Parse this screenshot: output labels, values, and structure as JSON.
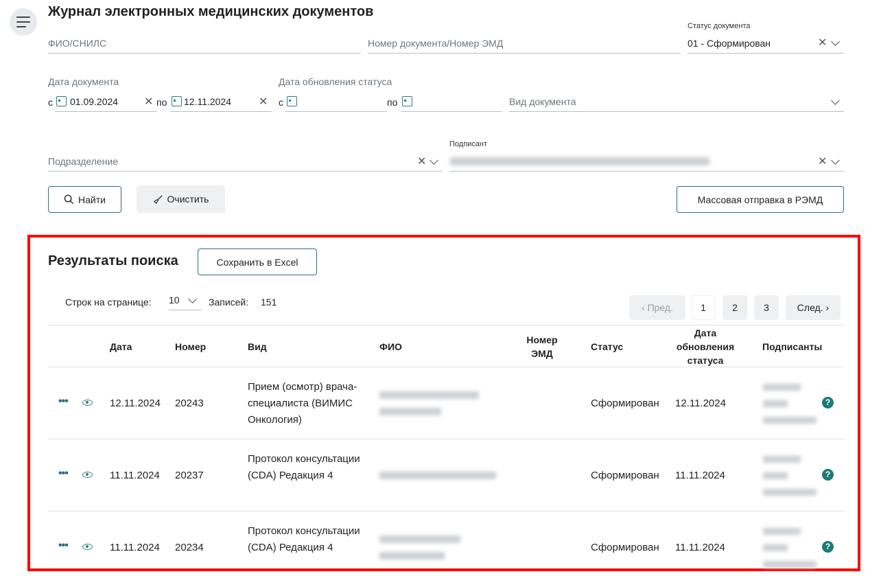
{
  "page_title": "Журнал электронных медицинских документов",
  "filters": {
    "fio_placeholder": "ФИО/СНИЛС",
    "number_placeholder": "Номер документа/Номер ЭМД",
    "status_label": "Статус документа",
    "status_value": "01 - Сформирован",
    "doc_date_label": "Дата документа",
    "from": "с",
    "to": "по",
    "doc_date_from": "01.09.2024",
    "doc_date_to": "12.11.2024",
    "status_date_label": "Дата обновления статуса",
    "doc_type_placeholder": "Вид документа",
    "department_placeholder": "Подразделение",
    "signer_label": "Подписант"
  },
  "buttons": {
    "find": "Найти",
    "clear": "Очистить",
    "mass_send": "Массовая отправка в РЭМД",
    "excel": "Сохранить в Excel"
  },
  "results": {
    "title": "Результаты поиска",
    "rows_per_page_label": "Строк на странице:",
    "rows_per_page": "10",
    "records_label": "Записей:",
    "records": "151",
    "pagination": {
      "prev": "Пред.",
      "pages": [
        "1",
        "2",
        "3"
      ],
      "next": "След."
    }
  },
  "table": {
    "headers": {
      "date": "Дата",
      "number": "Номер",
      "type": "Вид",
      "fio": "ФИО",
      "emd": "Номер\nЭМД",
      "status": "Статус",
      "status_date": "Дата\nобновления\nстатуса",
      "signers": "Подписанты"
    },
    "rows": [
      {
        "date": "12.11.2024",
        "number": "20243",
        "type": "Прием (осмотр) врача-специалиста (ВИМИС Онкология)",
        "status": "Сформирован",
        "status_date": "12.11.2024"
      },
      {
        "date": "11.11.2024",
        "number": "20237",
        "type": "Протокол консультации (CDA) Редакция 4",
        "status": "Сформирован",
        "status_date": "11.11.2024"
      },
      {
        "date": "11.11.2024",
        "number": "20234",
        "type": "Протокол консультации (CDA) Редакция 4",
        "status": "Сформирован",
        "status_date": "11.11.2024"
      }
    ]
  },
  "icons": {
    "menu": "hamburger-icon",
    "search": "search-icon",
    "broom": "broom-icon",
    "calendar": "calendar-icon",
    "eye": "eye-icon",
    "more": "more-icon",
    "help": "help-icon"
  }
}
